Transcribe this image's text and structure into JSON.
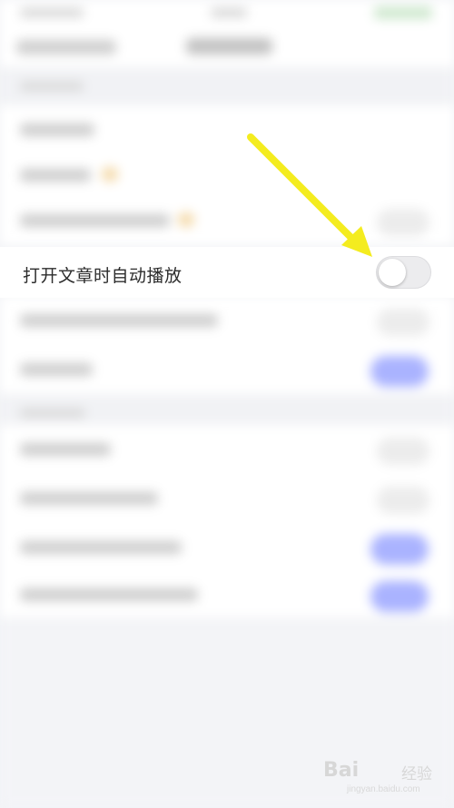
{
  "settings": {
    "autoplay_row": {
      "label": "打开文章时自动播放",
      "switch_state": "off"
    }
  },
  "colors": {
    "arrow": "#f4ec1f",
    "switch_off_track": "#ececee",
    "switch_on_track": "#8c96ff"
  },
  "watermark": {
    "logo": "Bai",
    "text": "经验",
    "url": "jingyan.baidu.com"
  }
}
